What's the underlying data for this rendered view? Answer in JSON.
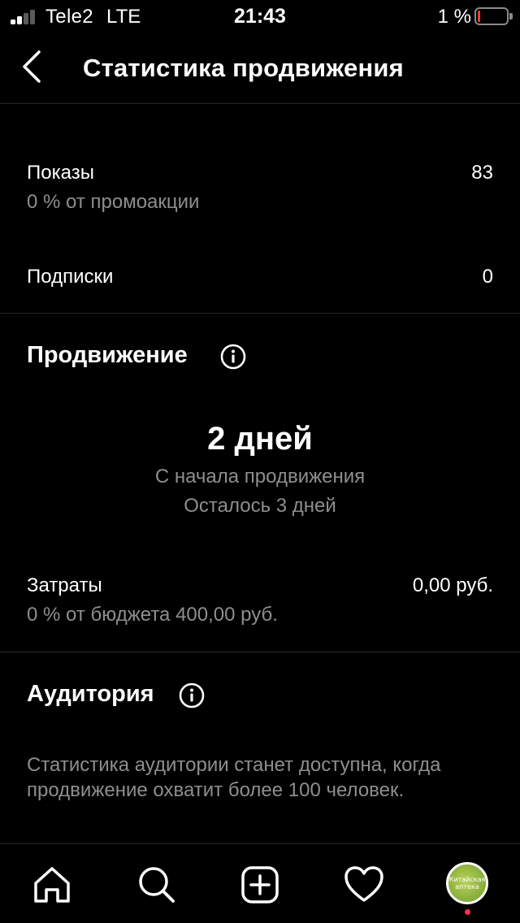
{
  "status_bar": {
    "carrier": "Tele2",
    "network": "LTE",
    "time": "21:43",
    "battery_percent": "1 %",
    "signal_bars": 4,
    "signal_bars_active": 2,
    "battery_level": 0.01
  },
  "header": {
    "title": "Статистика продвижения",
    "back_icon": "chevron-left-icon"
  },
  "metrics": {
    "impressions": {
      "label": "Показы",
      "value": "83",
      "sub": "0 % от промоакции"
    },
    "follows": {
      "label": "Подписки",
      "value": "0"
    }
  },
  "promotion": {
    "title": "Продвижение",
    "days": "2 дней",
    "since_label": "С начала продвижения",
    "remaining": "Осталось 3 дней"
  },
  "spend": {
    "label": "Затраты",
    "value": "0,00 руб.",
    "sub": "0 % от бюджета 400,00 руб."
  },
  "audience": {
    "title": "Аудитория",
    "note": "Статистика аудитории станет доступна, когда продвижение охватит более 100 человек."
  },
  "tab_bar": {
    "tabs": [
      "home-icon",
      "search-icon",
      "create-icon",
      "heart-icon",
      "profile-avatar"
    ],
    "avatar_text": "Китайская аптека"
  },
  "colors": {
    "background": "#000000",
    "text": "#ffffff",
    "secondary_text": "#8e8e8e",
    "divider": "#262626",
    "notification": "#ff3040",
    "battery_low": "#ff3b30"
  }
}
